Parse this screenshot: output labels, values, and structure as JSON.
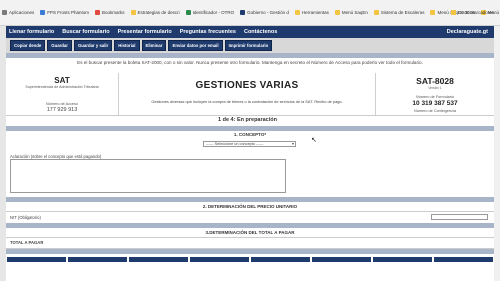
{
  "browser": {
    "bookmarks": [
      {
        "label": "Aplicaciones",
        "color": "#7a7a7a"
      },
      {
        "label": "FPS Frosts Phantom",
        "color": "#3a7bd5"
      },
      {
        "label": "Bookmarks",
        "color": "#e04a3f"
      },
      {
        "label": "Estrategias de descri",
        "color": "#f4c542"
      },
      {
        "label": "Identificador - OTRO",
        "color": "#2d8a4e"
      },
      {
        "label": "Gobierno - Gestión d",
        "color": "#1f3b6e"
      },
      {
        "label": "Herramientas",
        "color": "#f4c542"
      },
      {
        "label": "Menú SaqEn",
        "color": "#f4c542"
      },
      {
        "label": "Sistema de Escaleras",
        "color": "#f4c542"
      },
      {
        "label": "Menú SaqEn 3016",
        "color": "#f4c542"
      },
      {
        "label": "Menú SaqEn web",
        "color": "#f4c542"
      }
    ],
    "other_bookmarks": "Otros marcadores"
  },
  "navbar": {
    "items": [
      "Llenar formulario",
      "Buscar formulario",
      "Presentar formulario",
      "Preguntas frecuentes",
      "Contáctenos"
    ],
    "site": "Declaraguate.gt"
  },
  "toolbar": {
    "buttons": [
      "Copiar desde",
      "Guardar",
      "Guardar y salir",
      "Historial",
      "Eliminar",
      "Enviar datos por email",
      "Imprimir formulario"
    ]
  },
  "form": {
    "notice": "Es el buscar presente la boleta SAT-2000, con o sin valor. Nunca presente otro formulario. Mantenga en secreto el Número de Acceso para poderlo ver todo el formulario.",
    "agency": "SAT",
    "agency_sub": "Superintendencia de Administración Tributaria",
    "access_label": "Número de Acceso",
    "access_number": "177 929 913",
    "title": "GESTIONES VARIAS",
    "description": "Gestiones diversas que incluyen la compra de bienes o la contratación de servicios de la SAT. Recibo de pago.",
    "form_code": "SAT-8028",
    "version": "Versión 1",
    "form_number_label": "Número de Formulario",
    "form_number": "10 319 387 537",
    "contingency_label": "Número de Contingencia",
    "step": "1 de 4: En preparación",
    "section1_title": "1. CONCEPTO*",
    "select_value": "------ Seleccione un concepto ------",
    "explain_label": "Aclaración (sobre el concepto que está pagando)",
    "section2_title": "2. DETERMINACIÓN DEL PRECIO UNITARIO",
    "nit_label": "NIT (Obligatorio)",
    "section3_title": "3.DETERMINACIÓN DEL TOTAL A PAGAR",
    "total_label": "TOTAL A PAGAR"
  }
}
